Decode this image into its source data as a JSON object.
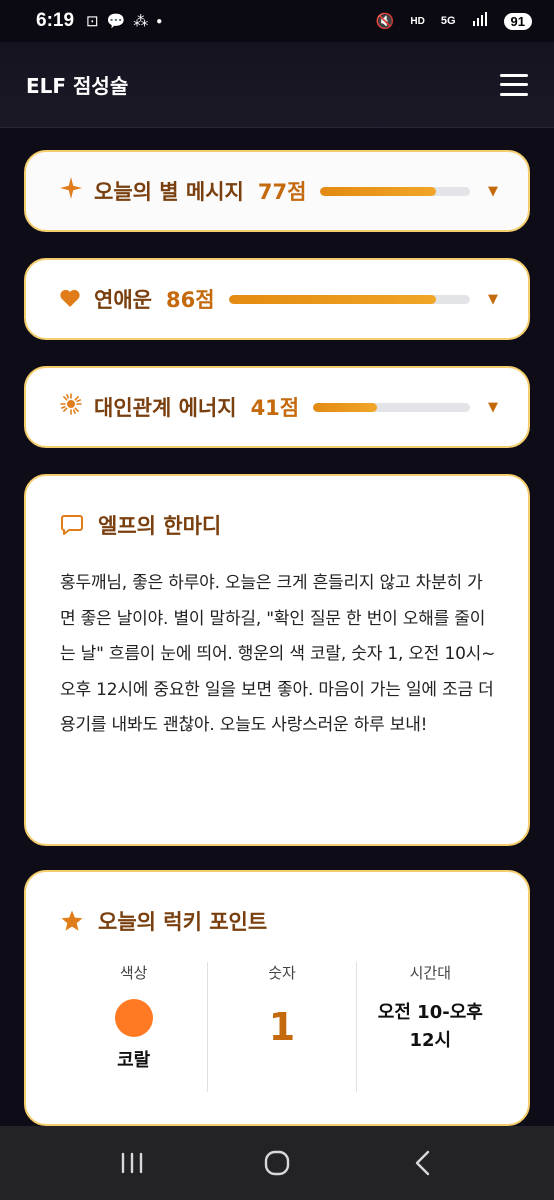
{
  "status": {
    "time": "6:19",
    "battery": "91",
    "icons_left": [
      "screenshot-icon",
      "chat-icon",
      "grid-icon",
      "dot-icon"
    ],
    "icons_right": [
      "mute-icon",
      "hd-voice-icon",
      "5g-icon",
      "signal-icon"
    ]
  },
  "app": {
    "title": "ELF 점성술"
  },
  "scores": [
    {
      "label": "오늘의 별 메시지",
      "score": "77점",
      "value": 77
    },
    {
      "label": "연애운",
      "score": "86점",
      "value": 86
    },
    {
      "label": "대인관계 에너지",
      "score": "41점",
      "value": 41
    }
  ],
  "message": {
    "title": "엘프의 한마디",
    "body": "홍두깨님, 좋은 하루야. 오늘은 크게 흔들리지 않고 차분히 가면 좋은 날이야. 별이 말하길, \"확인 질문 한 번이 오해를 줄이는 날\" 흐름이 눈에 띄어. 행운의 색 코랄, 숫자 1, 오전 10시~오후 12시에 중요한 일을 보면 좋아. 마음이 가는 일에 조금 더 용기를 내봐도 괜찮아. 오늘도 사랑스러운 하루 보내!"
  },
  "lucky": {
    "title": "오늘의 럭키 포인트",
    "color_label": "색상",
    "color_value": "코랄",
    "color_hex": "#ff7a23",
    "number_label": "숫자",
    "number_value": "1",
    "time_label": "시간대",
    "time_value": "오전 10-오후 12시"
  },
  "colors": {
    "accent": "#e07d1a",
    "border": "#f4cd6c",
    "title_brown": "#7a3f0e"
  }
}
